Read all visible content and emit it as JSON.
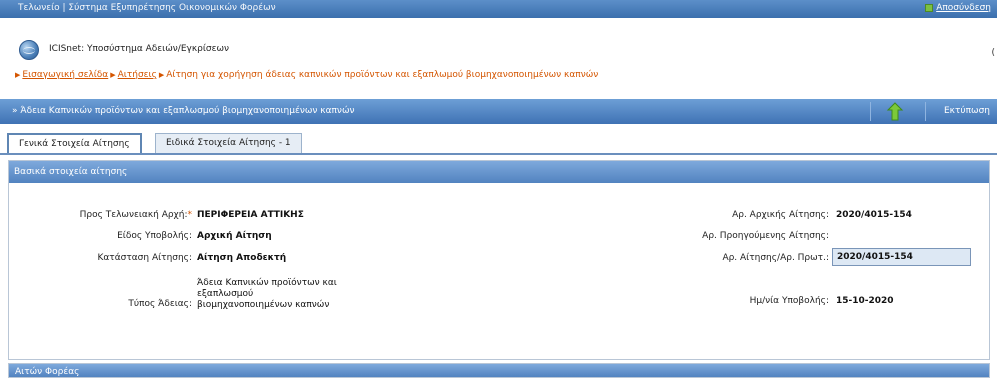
{
  "topbar": {
    "title": "Τελωνείο | Σύστημα Εξυπηρέτησης Οικονομικών Φορέων",
    "user_link": "Αποσύνδεση"
  },
  "header": {
    "app_title": "ICISnet: Υποσύστημα Αδειών/Εγκρίσεων",
    "right_mark": "("
  },
  "breadcrumb": {
    "items": [
      "Εισαγωγική σελίδα",
      "Αιτήσεις",
      "Αίτηση για χορήγηση άδειας καπνικών προϊόντων και εξαπλωμού βιομηχανοποιημένων καπνών"
    ]
  },
  "section_bar": {
    "title": "» Άδεια Καπνικών προϊόντων και εξαπλωσμού βιομηχανοποιημένων καπνών",
    "print_label": "Εκτύπωση"
  },
  "tabs": [
    {
      "label": "Γενικά Στοιχεία Αίτησης",
      "active": true
    },
    {
      "label": "Ειδικά Στοιχεία Αίτησης - 1",
      "active": false
    }
  ],
  "panel": {
    "title": "Βασικά στοιχεία αίτησης",
    "fields_left": [
      {
        "label": "Προς Τελωνειακή Αρχή:",
        "required": "*",
        "value": "ΠΕΡΙΦΕΡΕΙΑ ΑΤΤΙΚΗΣ"
      },
      {
        "label": "Είδος Υποβολής:",
        "value": "Αρχική Αίτηση"
      },
      {
        "label": "Κατάσταση Αίτησης:",
        "value": "Αίτηση Αποδεκτή"
      },
      {
        "label": "Τύπος Άδειας:",
        "value": "Άδεια Καπνικών προϊόντων και εξαπλωσμού βιομηχανοποιημένων καπνών"
      }
    ],
    "fields_right": [
      {
        "label": "Αρ. Αρχικής Αίτησης:",
        "value": "2020/4015-154"
      },
      {
        "label": "Αρ. Προηγούμενης Αίτησης:",
        "value": ""
      },
      {
        "label": "Αρ. Αίτησης/Αρ. Πρωτ.:",
        "value": "2020/4015-154"
      },
      {
        "label": "Ημ/νία Υποβολής:",
        "value": "15-10-2020"
      }
    ]
  },
  "panel2": {
    "title": "Αιτών Φορέας"
  },
  "colors": {
    "accent": "#3f72b4",
    "link": "#d45500"
  }
}
